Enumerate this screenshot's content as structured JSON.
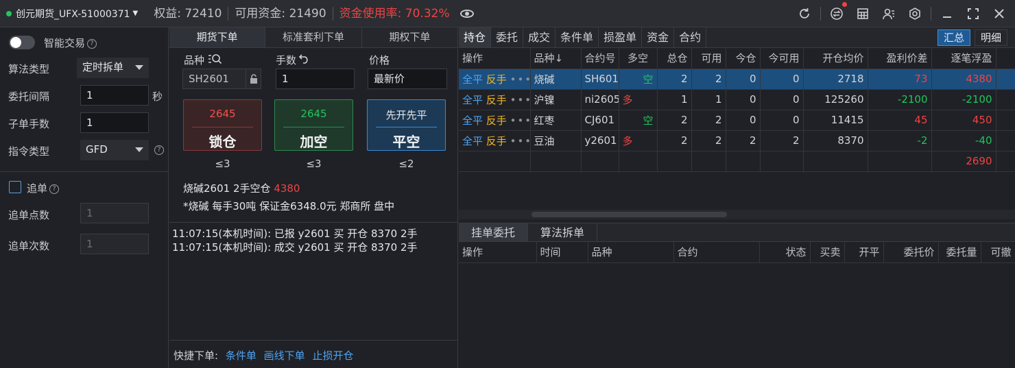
{
  "topbar": {
    "account": "创元期货_UFX-51000371",
    "equity": "权益: 72410",
    "available": "可用资金: 21490",
    "usage": "资金使用率: 70.32%"
  },
  "left": {
    "smart_trade": "智能交易",
    "algo_type_label": "算法类型",
    "algo_type_value": "定时拆单",
    "interval_label": "委托间隔",
    "interval_value": "1",
    "interval_unit": "秒",
    "child_qty_label": "子单手数",
    "child_qty_value": "1",
    "order_type_label": "指令类型",
    "order_type_value": "GFD",
    "chase_label": "追单",
    "chase_points_label": "追单点数",
    "chase_points_value": "1",
    "chase_times_label": "追单次数",
    "chase_times_value": "1"
  },
  "mid": {
    "tabs": [
      "期货下单",
      "标准套利下单",
      "期权下单"
    ],
    "symbol_label": "品种",
    "qty_label": "手数",
    "price_label": "价格",
    "symbol_value": "SH2601",
    "qty_value": "1",
    "price_value": "最新价",
    "buttons": [
      {
        "top": "2645",
        "main": "锁仓",
        "limit": "≤3"
      },
      {
        "top": "2645",
        "main": "加空",
        "limit": "≤3"
      },
      {
        "top": "先开先平",
        "main": "平空",
        "limit": "≤2"
      }
    ],
    "pos_line_prefix": "烧碱2601  2手空仓",
    "pos_line_value": "4380",
    "info_line": "*烧碱 每手30吨 保证金6348.0元 郑商所 盘中",
    "logs": [
      "11:07:15(本机时间): 已报 y2601 买 开仓 8370 2手",
      "11:07:15(本机时间): 成交 y2601 买 开仓 8370 2手"
    ],
    "quick_label": "快捷下单:",
    "quick_links": [
      "条件单",
      "画线下单",
      "止损开仓"
    ]
  },
  "right": {
    "tabs": [
      "持仓",
      "委托",
      "成交",
      "条件单",
      "损盈单",
      "资金",
      "合约"
    ],
    "summary_btn": "汇总",
    "detail_btn": "明细",
    "columns": [
      "操作",
      "品种↓",
      "合约号",
      "多空",
      "总仓",
      "可用",
      "今仓",
      "今可用",
      "开仓均价",
      "盈利价差",
      "逐笔浮盈"
    ],
    "action_close": "全平",
    "action_reverse": "反手",
    "rows": [
      {
        "name": "烧碱",
        "code": "SH601",
        "dir": "空",
        "total": "2",
        "avail": "2",
        "today": "0",
        "today_avail": "0",
        "avg": "2718",
        "diff": "73",
        "pnl": "4380"
      },
      {
        "name": "沪镍",
        "code": "ni2605",
        "dir": "多",
        "total": "1",
        "avail": "1",
        "today": "0",
        "today_avail": "0",
        "avg": "125260",
        "diff": "-2100",
        "pnl": "-2100"
      },
      {
        "name": "红枣",
        "code": "CJ601",
        "dir": "空",
        "total": "2",
        "avail": "2",
        "today": "0",
        "today_avail": "0",
        "avg": "11415",
        "diff": "45",
        "pnl": "450"
      },
      {
        "name": "豆油",
        "code": "y2601",
        "dir": "多",
        "total": "2",
        "avail": "2",
        "today": "2",
        "today_avail": "2",
        "avg": "8370",
        "diff": "-2",
        "pnl": "-40"
      }
    ],
    "total_pnl": "2690",
    "bottom_tabs": [
      "挂单委托",
      "算法拆单"
    ],
    "order_columns": [
      "操作",
      "时间",
      "品种",
      "合约",
      "状态",
      "买卖",
      "开平",
      "委托价",
      "委托量",
      "可撤"
    ]
  }
}
